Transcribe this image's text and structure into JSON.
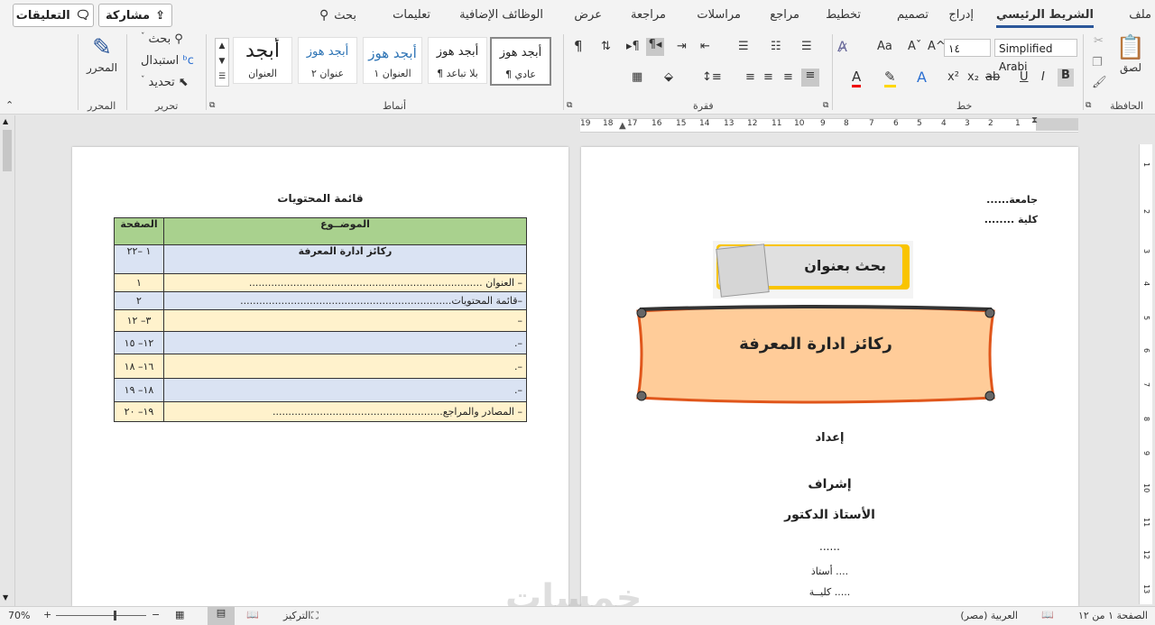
{
  "tabs": [
    "ملف",
    "الشريط الرئيسي",
    "إدراج",
    "تصميم",
    "تخطيط",
    "مراجع",
    "مراسلات",
    "مراجعة",
    "عرض",
    "الوظائف الإضافية",
    "تعليمات"
  ],
  "search_label": "بحث",
  "share_label": "مشاركة",
  "comments_label": "التعليقات",
  "clipboard": {
    "paste": "لصق",
    "group": "الحافظة"
  },
  "font": {
    "name": "Simplified Arabi",
    "size": "١٤",
    "group": "خط",
    "grow": "A^",
    "shrink": "Aˇ",
    "case": "Aa",
    "bold": "B",
    "italic": "I",
    "underline": "U",
    "strike": "ab",
    "sub": "x₂",
    "sup": "x²"
  },
  "paragraph": {
    "group": "فقرة"
  },
  "styles": {
    "group": "أنماط",
    "items": [
      {
        "sample": "أبجد هوز",
        "name": "¶ عادي"
      },
      {
        "sample": "أبجد هوز",
        "name": "¶ بلا تباعد"
      },
      {
        "sample": "أبجد هوز",
        "name": "العنوان ١"
      },
      {
        "sample": "أبجد هوز",
        "name": "عنوان ٢"
      },
      {
        "sample": "أبجد",
        "name": "العنوان"
      }
    ]
  },
  "editing": {
    "find": "بحث",
    "replace": "استبدال",
    "select": "تحديد",
    "group": "تحرير"
  },
  "editor": {
    "label": "المحرر",
    "group": "المحرر"
  },
  "ruler_numbers": [
    "1",
    "2",
    "3",
    "4",
    "5",
    "6",
    "7",
    "8",
    "9",
    "10",
    "11",
    "12",
    "13",
    "14",
    "15",
    "16",
    "17",
    "18",
    "19"
  ],
  "vruler_numbers": [
    "1",
    "2",
    "3",
    "4",
    "5",
    "6",
    "7",
    "8",
    "9",
    "10",
    "11",
    "12",
    "13"
  ],
  "page1": {
    "university": "جامعة......",
    "college": "كلية ........",
    "banner_label": "بحث بعنوان",
    "title": "ركائز ادارة المعرفة",
    "prepared_by": "إعداد",
    "supervision": "إشراف",
    "professor": "الأستاذ الدكتور",
    "dots": "......",
    "prof_title": "أستاذ ....",
    "prof_college": "كليــة ....."
  },
  "page2": {
    "heading": "قائمة المحتويات",
    "table": {
      "headers": [
        "الموضــوع",
        "الصفحة"
      ],
      "rows": [
        {
          "topic": "ركائز ادارة المعرفة",
          "page": "١ –٢٢"
        },
        {
          "topic": "– العنوان ..........................................................................",
          "page": "١"
        },
        {
          "topic": "–قائمة المحتويات...................................................................",
          "page": "٢"
        },
        {
          "topic": "–",
          "page": "٣– ١٢"
        },
        {
          "topic": "–.",
          "page": "١٢– ١٥"
        },
        {
          "topic": "–.",
          "page": "١٦– ١٨"
        },
        {
          "topic": "–.",
          "page": "١٨– ١٩"
        },
        {
          "topic": "– المصادر والمراجع......................................................",
          "page": "١٩– ٢٠"
        }
      ]
    }
  },
  "watermark": "خمسات",
  "status": {
    "page": "الصفحة ١ من ١٢",
    "language": "العربية (مصر)",
    "focus": "التركيز",
    "zoom": "70%"
  },
  "colors": {
    "accent": "#2b579a",
    "header_green": "#a9d18e",
    "row_blue": "#dae3f3",
    "row_yellow": "#fff2cc",
    "banner": "#ffcc99"
  }
}
